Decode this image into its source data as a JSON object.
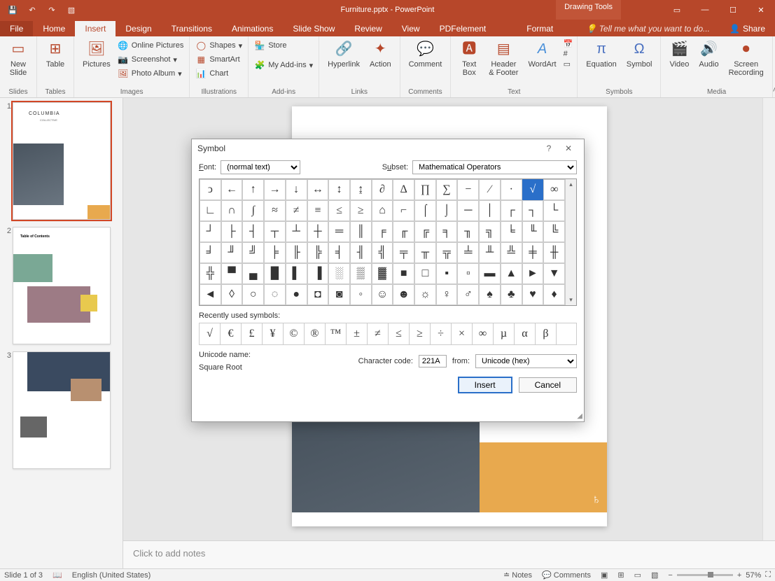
{
  "titlebar": {
    "title": "Furniture.pptx - PowerPoint",
    "drawing_tools": "Drawing Tools"
  },
  "tabs": {
    "file": "File",
    "home": "Home",
    "insert": "Insert",
    "design": "Design",
    "transitions": "Transitions",
    "animations": "Animations",
    "slideshow": "Slide Show",
    "review": "Review",
    "view": "View",
    "pdfelement": "PDFelement",
    "format": "Format",
    "tellme": "Tell me what you want to do...",
    "share": "Share"
  },
  "ribbon": {
    "new_slide": "New\nSlide",
    "slides": "Slides",
    "table": "Table",
    "tables": "Tables",
    "pictures": "Pictures",
    "online_pictures": "Online Pictures",
    "screenshot": "Screenshot",
    "photo_album": "Photo Album",
    "images": "Images",
    "shapes": "Shapes",
    "smartart": "SmartArt",
    "chart": "Chart",
    "illustrations": "Illustrations",
    "store": "Store",
    "my_addins": "My Add-ins",
    "addins": "Add-ins",
    "hyperlink": "Hyperlink",
    "action": "Action",
    "links": "Links",
    "comment": "Comment",
    "comments": "Comments",
    "text_box": "Text\nBox",
    "header_footer": "Header\n& Footer",
    "wordart": "WordArt",
    "text": "Text",
    "equation": "Equation",
    "symbol": "Symbol",
    "symbols": "Symbols",
    "video": "Video",
    "audio": "Audio",
    "screen_recording": "Screen\nRecording",
    "media": "Media"
  },
  "dialog": {
    "title": "Symbol",
    "font_label": "Font:",
    "font_value": "(normal text)",
    "subset_label": "Subset:",
    "subset_value": "Mathematical Operators",
    "grid": [
      "ↄ",
      "←",
      "↑",
      "→",
      "↓",
      "↔",
      "↕",
      "↨",
      "∂",
      "∆",
      "∏",
      "∑",
      "−",
      "∕",
      "∙",
      "√",
      "∞",
      "∟",
      "∩",
      "∫",
      "≈",
      "≠",
      "≡",
      "≤",
      "≥",
      "⌂",
      "⌐",
      "⌠",
      "⌡",
      "─",
      "│",
      "┌",
      "┐",
      "└",
      "┘",
      "├",
      "┤",
      "┬",
      "┴",
      "┼",
      "═",
      "║",
      "╒",
      "╓",
      "╔",
      "╕",
      "╖",
      "╗",
      "╘",
      "╙",
      "╚",
      "╛",
      "╜",
      "╝",
      "╞",
      "╟",
      "╠",
      "╡",
      "╢",
      "╣",
      "╤",
      "╥",
      "╦",
      "╧",
      "╨",
      "╩",
      "╪",
      "╫",
      "╬",
      "▀",
      "▄",
      "█",
      "▌",
      "▐",
      "░",
      "▒",
      "▓",
      "■",
      "□",
      "▪",
      "▫",
      "▬",
      "▲",
      "►",
      "▼",
      "◄",
      "◊",
      "○",
      "◌",
      "●",
      "◘",
      "◙",
      "◦",
      "☺",
      "☻",
      "☼",
      "♀",
      "♂",
      "♠",
      "♣",
      "♥",
      "♦"
    ],
    "selected_index": 15,
    "recent_label": "Recently used symbols:",
    "recent": [
      "√",
      "€",
      "£",
      "¥",
      "©",
      "®",
      "™",
      "±",
      "≠",
      "≤",
      "≥",
      "÷",
      "×",
      "∞",
      "µ",
      "α",
      "β"
    ],
    "unicode_name_label": "Unicode name:",
    "unicode_name_value": "Square Root",
    "char_code_label": "Character code:",
    "char_code_value": "221A",
    "from_label": "from:",
    "from_value": "Unicode (hex)",
    "insert": "Insert",
    "cancel": "Cancel"
  },
  "slide_thumbs": {
    "s1_title": "COLUMBIA",
    "s1_sub": "COLLECTIVE",
    "s2_toc": "Table of Contents"
  },
  "notes": {
    "placeholder": "Click to add notes"
  },
  "statusbar": {
    "slide_info": "Slide 1 of 3",
    "language": "English (United States)",
    "notes": "Notes",
    "comments": "Comments",
    "zoom": "57%"
  }
}
